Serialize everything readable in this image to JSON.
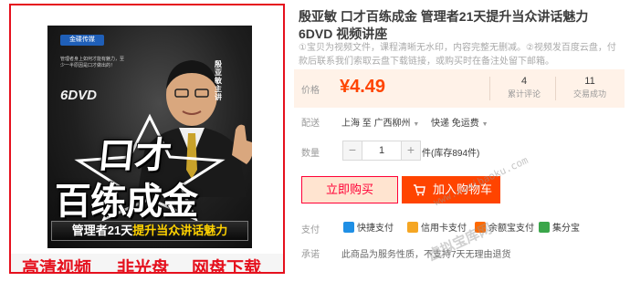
{
  "product": {
    "title": "殷亚敏 口才百练成金 管理者21天提升当众讲话魅力 6DVD 视频讲座",
    "subtitle": "①宝贝为视频文件，课程清晰无水印，内容完整无删减。②视频发百度云盘，付款后联系我们索取云盘下载链接，或购买时在备注处留下邮箱。"
  },
  "cover": {
    "publisher_badge": "金碟传媒",
    "intro_text": "管理者身上如何才能有魅力，至少一半原因是口才做出的！",
    "dvd_mark": "6DVD",
    "speaker_name": "殷亚敏主讲",
    "title_line1": "口才",
    "title_line2": "百练成金",
    "banner_part1": "管理者21天",
    "banner_part2": "提升当众讲话魅力",
    "promo": [
      "高清视频",
      "非光盘",
      "网盘下载"
    ]
  },
  "price": {
    "label": "价格",
    "value": "¥4.49",
    "reviews_count": "4",
    "reviews_label": "累计评论",
    "sales_count": "11",
    "sales_label": "交易成功"
  },
  "shipping": {
    "label": "配送",
    "from": "上海 至",
    "to": "广西柳州",
    "method": "快递 免运费"
  },
  "quantity": {
    "label": "数量",
    "minus": "−",
    "value": "1",
    "plus": "+",
    "unit_stock": "件(库存894件)"
  },
  "buttons": {
    "buy_now": "立即购买",
    "add_to_cart": "加入购物车"
  },
  "payment": {
    "label": "支付",
    "methods": [
      {
        "name": "快捷支付",
        "color": "#1f8fe5"
      },
      {
        "name": "信用卡支付",
        "color": "#f5a623"
      },
      {
        "name": "余额宝支付",
        "color": "#ff6a00"
      },
      {
        "name": "集分宝",
        "color": "#3aa64a"
      }
    ]
  },
  "promise": {
    "label": "承诺",
    "text": "此商品为服务性质，不支持7天无理由退货"
  },
  "watermark": {
    "url": "www.xunibaoku.com",
    "cn": "虚拟宝库网"
  },
  "colors": {
    "price_orange": "#ff4400",
    "buy_red": "#ff0036",
    "border_red": "#e5101d"
  }
}
